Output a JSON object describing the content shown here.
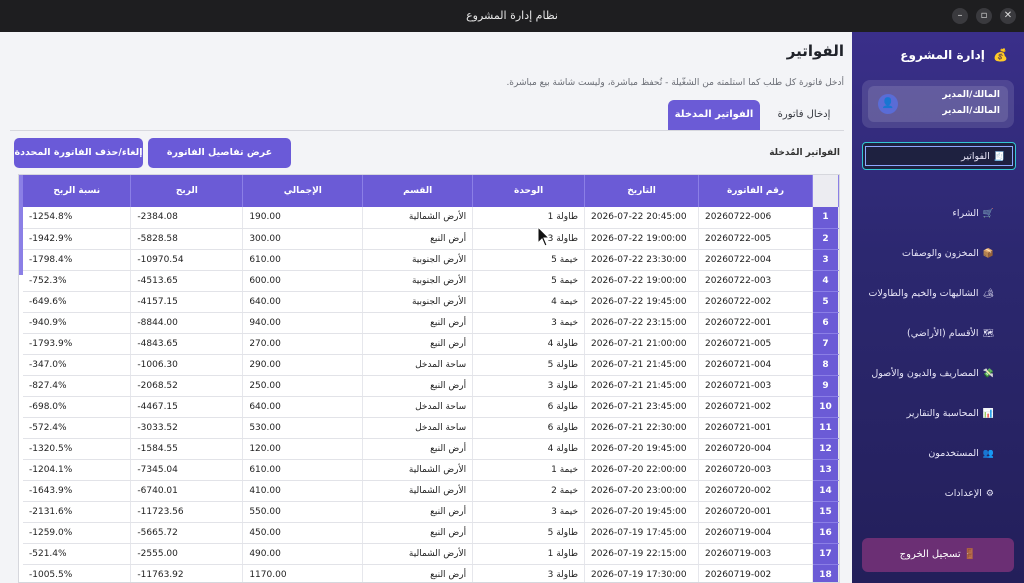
{
  "window": {
    "title": "نظام إدارة المشروع",
    "buttons": [
      "–",
      "▫",
      "✕"
    ]
  },
  "sidebar": {
    "header": "إدارة المشروع",
    "header_icon": "💰",
    "user": {
      "line1": "المالك/المدير",
      "line2": "المالك/المدير",
      "avatar": "👤"
    },
    "items": [
      {
        "label": "الفواتير",
        "icon": "🧾",
        "active": true
      },
      {
        "label": "الشراء",
        "icon": "🛒"
      },
      {
        "label": "المخزون والوصفات",
        "icon": "📦"
      },
      {
        "label": "الشاليهات والخيم والطاولات",
        "icon": "🏕"
      },
      {
        "label": "الأقسام (الأراضي)",
        "icon": "🗺"
      },
      {
        "label": "المصاريف والديون والأصول",
        "icon": "💸"
      },
      {
        "label": "المحاسبة والتقارير",
        "icon": "📊"
      },
      {
        "label": "المستخدمون",
        "icon": "👥"
      },
      {
        "label": "الإعدادات",
        "icon": "⚙"
      }
    ],
    "logout": "تسجيل الخروج",
    "logout_icon": "🚪"
  },
  "main": {
    "title": "الفواتير",
    "description": "أدخل فاتورة كل طلب كما استلمته من الشغّيلة - تُحفظ مباشرة، وليست شاشة بيع مباشرة.",
    "tabs": {
      "active": "الفواتير المدخلة",
      "inactive": "إدخال فاتورة"
    },
    "list_label": "الفواتير المُدخلة",
    "buttons": {
      "details": "عرض تفاصيل الفاتورة المحددة",
      "delete": "إلغاء/حذف الفاتورة المحددة"
    },
    "columns": [
      "رقم الفاتورة",
      "التاريخ",
      "الوحدة",
      "القسم",
      "الإجمالي",
      "الربح",
      "نسبة الربح"
    ],
    "rows": [
      [
        "20260722-006",
        "2026-07-22 20:45:00",
        "طاولة 1",
        "الأرض الشمالية",
        "190.00",
        "-2384.08",
        "-1254.8%"
      ],
      [
        "20260722-005",
        "2026-07-22 19:00:00",
        "طاولة 3",
        "أرض النبع",
        "300.00",
        "-5828.58",
        "-1942.9%"
      ],
      [
        "20260722-004",
        "2026-07-22 23:30:00",
        "خيمة 5",
        "الأرض الجنوبية",
        "610.00",
        "-10970.54",
        "-1798.4%"
      ],
      [
        "20260722-003",
        "2026-07-22 19:00:00",
        "خيمة 5",
        "الأرض الجنوبية",
        "600.00",
        "-4513.65",
        "-752.3%"
      ],
      [
        "20260722-002",
        "2026-07-22 19:45:00",
        "خيمة 4",
        "الأرض الجنوبية",
        "640.00",
        "-4157.15",
        "-649.6%"
      ],
      [
        "20260722-001",
        "2026-07-22 23:15:00",
        "خيمة 3",
        "أرض النبع",
        "940.00",
        "-8844.00",
        "-940.9%"
      ],
      [
        "20260721-005",
        "2026-07-21 21:00:00",
        "طاولة 4",
        "أرض النبع",
        "270.00",
        "-4843.65",
        "-1793.9%"
      ],
      [
        "20260721-004",
        "2026-07-21 21:45:00",
        "طاولة 5",
        "ساحة المدخل",
        "290.00",
        "-1006.30",
        "-347.0%"
      ],
      [
        "20260721-003",
        "2026-07-21 21:45:00",
        "طاولة 3",
        "أرض النبع",
        "250.00",
        "-2068.52",
        "-827.4%"
      ],
      [
        "20260721-002",
        "2026-07-21 23:45:00",
        "طاولة 6",
        "ساحة المدخل",
        "640.00",
        "-4467.15",
        "-698.0%"
      ],
      [
        "20260721-001",
        "2026-07-21 22:30:00",
        "طاولة 6",
        "ساحة المدخل",
        "530.00",
        "-3033.52",
        "-572.4%"
      ],
      [
        "20260720-004",
        "2026-07-20 19:45:00",
        "طاولة 4",
        "أرض النبع",
        "120.00",
        "-1584.55",
        "-1320.5%"
      ],
      [
        "20260720-003",
        "2026-07-20 22:00:00",
        "خيمة 1",
        "الأرض الشمالية",
        "610.00",
        "-7345.04",
        "-1204.1%"
      ],
      [
        "20260720-002",
        "2026-07-20 23:00:00",
        "خيمة 2",
        "الأرض الشمالية",
        "410.00",
        "-6740.01",
        "-1643.9%"
      ],
      [
        "20260720-001",
        "2026-07-20 19:45:00",
        "خيمة 3",
        "أرض النبع",
        "550.00",
        "-11723.56",
        "-2131.6%"
      ],
      [
        "20260719-004",
        "2026-07-19 17:45:00",
        "طاولة 5",
        "أرض النبع",
        "450.00",
        "-5665.72",
        "-1259.0%"
      ],
      [
        "20260719-003",
        "2026-07-19 22:15:00",
        "طاولة 1",
        "الأرض الشمالية",
        "490.00",
        "-2555.00",
        "-521.4%"
      ],
      [
        "20260719-002",
        "2026-07-19 17:30:00",
        "طاولة 3",
        "أرض النبع",
        "1170.00",
        "-11763.92",
        "-1005.5%"
      ]
    ]
  },
  "colors": {
    "accent": "#6b5bd6",
    "sidebar": "#2c2870",
    "titlebar": "#1e1e20"
  }
}
